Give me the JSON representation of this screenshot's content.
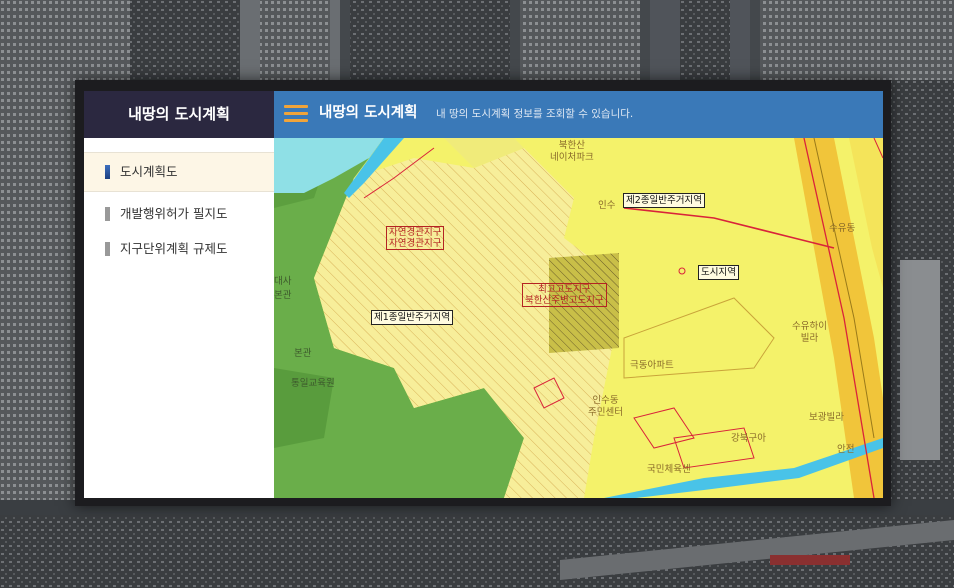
{
  "app": {
    "brand": "내땅의 도시계획"
  },
  "header": {
    "title": "내땅의 도시계획",
    "description": "내 땅의 도시계획 정보를 조회할 수 있습니다."
  },
  "sidebar": {
    "items": [
      {
        "label": "도시계획도",
        "active": true
      },
      {
        "label": "개발행위허가 필지도",
        "active": false
      },
      {
        "label": "지구단위계획 규제도",
        "active": false
      }
    ]
  },
  "map": {
    "zone_labels": [
      "제2종일반주거지역",
      "도시지역",
      "제1종일반주거지역"
    ],
    "district_labels": [
      {
        "line1": "자연경관지구",
        "line2": "자연경관지구"
      },
      {
        "line1": "최고고도지구",
        "line2": "북한산주변고도지구"
      }
    ],
    "places": {
      "north": "북한산",
      "nature_park": "네이처파크",
      "unit_small": "인수",
      "suyu": "수유동",
      "suyu_hi": "수유하이",
      "villa": "빌라",
      "daesa": "대사",
      "bogwan": "본관",
      "main_hall": "본관",
      "center": "통일교육원",
      "apt": "극동아파트",
      "insu_dong": "인수동",
      "community_center": "주민센터",
      "bogwang_villa": "보광빌라",
      "gangbuk": "강북구아",
      "national": "국민체육센",
      "ansan": "안전",
      "jeo": "본관"
    }
  }
}
